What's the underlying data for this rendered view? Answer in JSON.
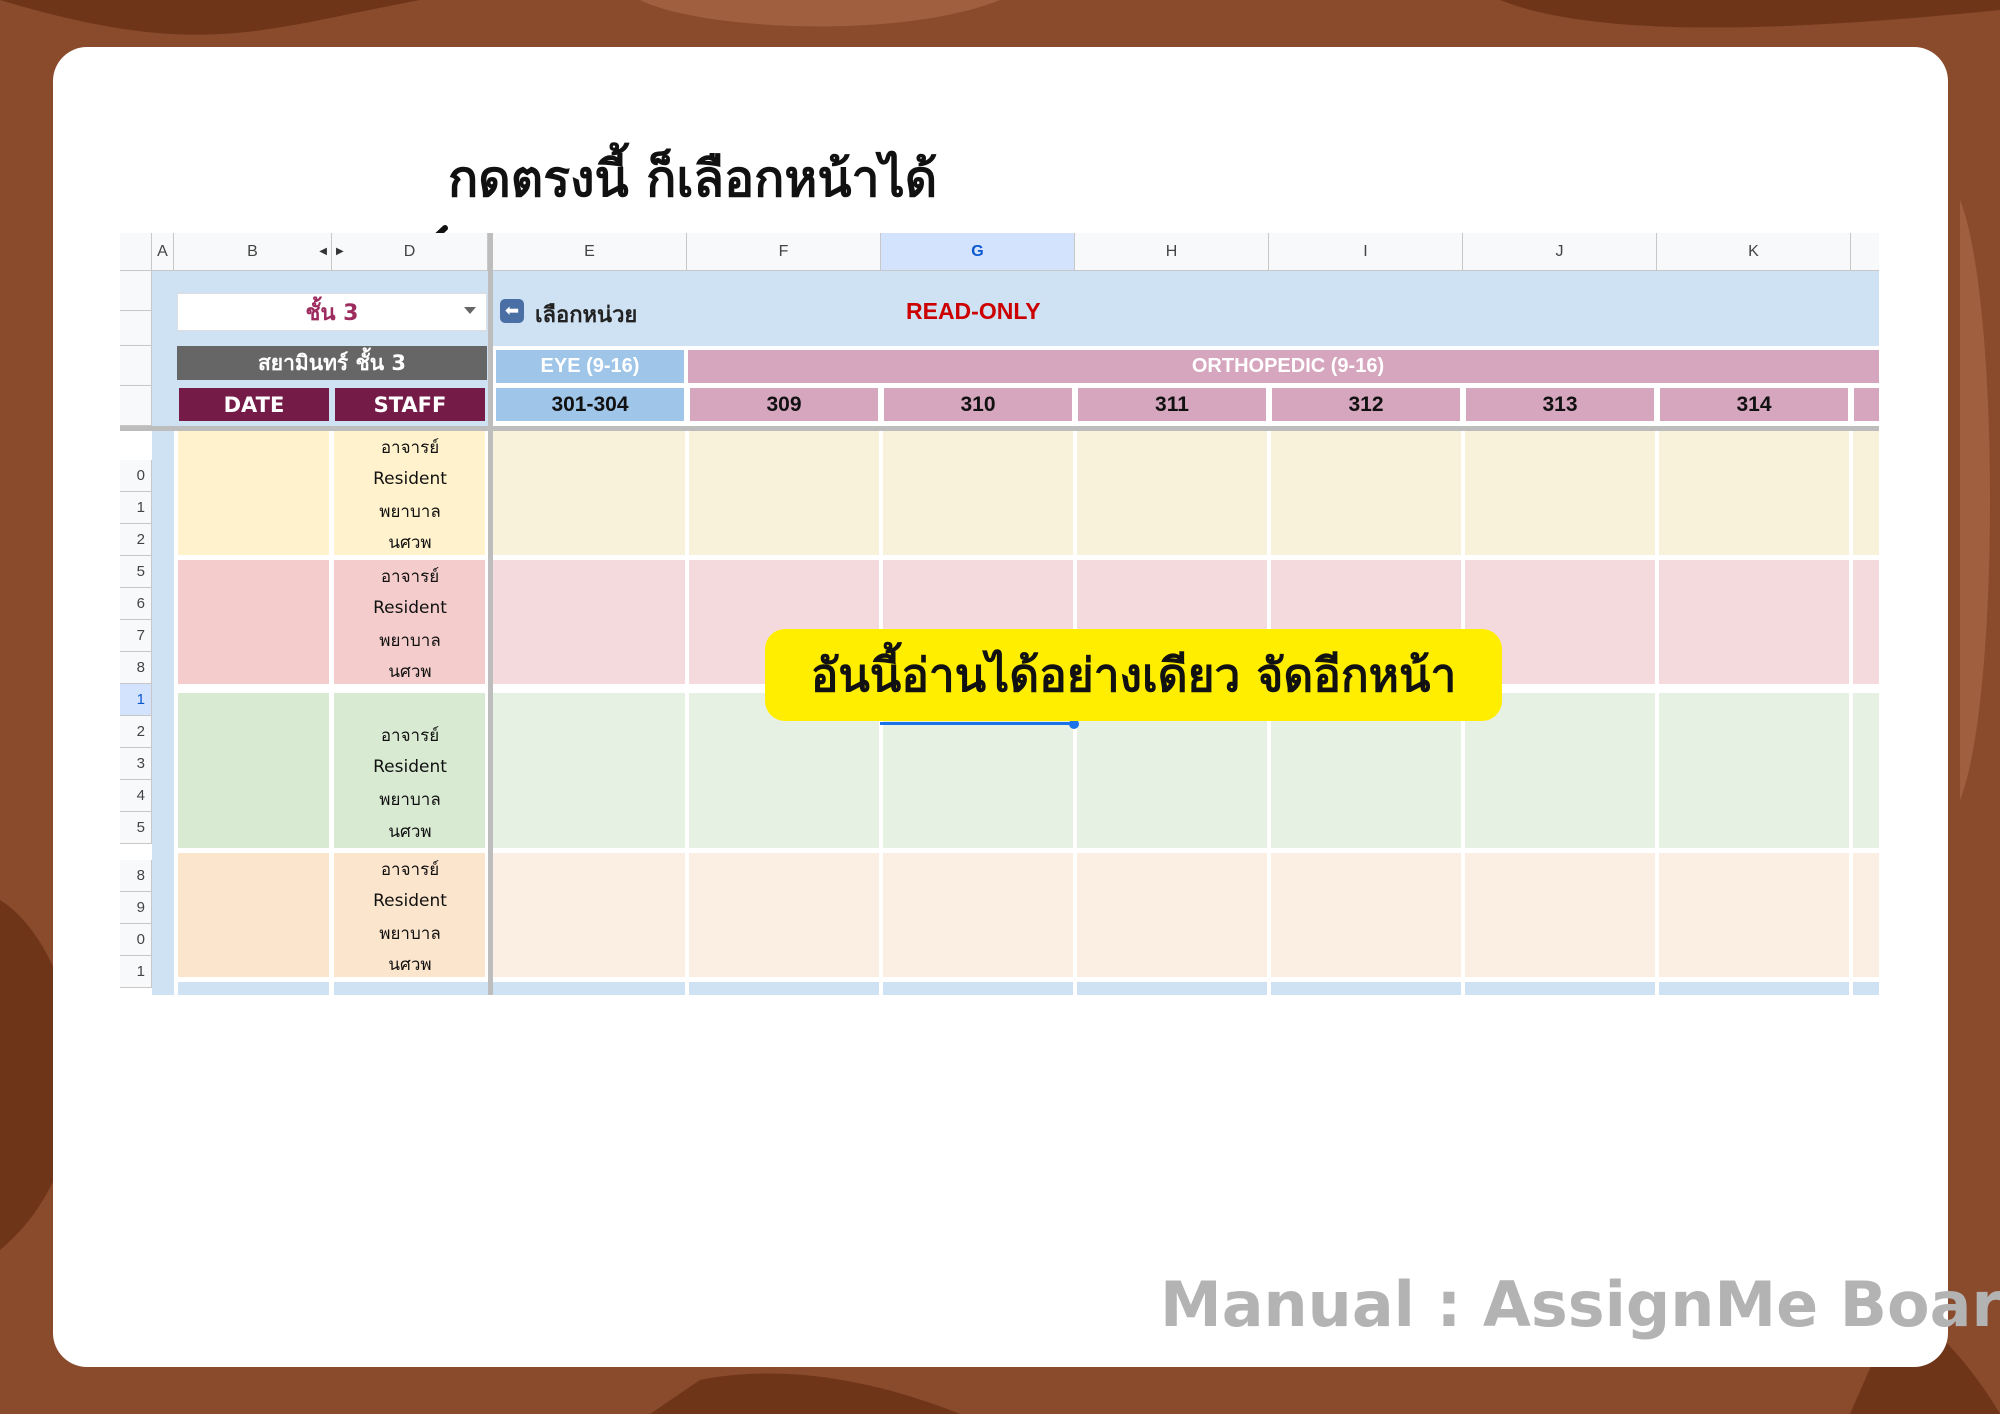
{
  "annotation_top": "กดตรงนี้ ก็เลือกหน้าได้",
  "annotation_banner": "อันนี้อ่านได้อย่างเดียว จัดอีกหน้า",
  "footer": "Manual : AssignMe Board",
  "colors": {
    "background": "#8a4a2c",
    "card": "#ffffff",
    "banner": "#ffee00",
    "readonly": "#cc0000",
    "maroon": "#741b47",
    "eye": "#9fc5e8",
    "ortho": "#d5a6bd"
  },
  "sheet": {
    "column_headers": [
      "A",
      "B",
      "D",
      "E",
      "F",
      "G",
      "H",
      "I",
      "J",
      "K"
    ],
    "selected_column": "G",
    "floor_selector": "ชั้น 3",
    "pick_unit_label": "เลือกหน่วย",
    "readonly_label": "READ-ONLY",
    "building_title": "สยามินทร์ ชั้น 3",
    "date_header": "DATE",
    "staff_header": "STAFF",
    "group_eye": "EYE (9-16)",
    "group_ortho": "ORTHOPEDIC (9-16)",
    "units": [
      "301-304",
      "309",
      "310",
      "311",
      "312",
      "313",
      "314"
    ],
    "row_numbers": [
      "0",
      "1",
      "2",
      "5",
      "6",
      "7",
      "8",
      "1",
      "2",
      "3",
      "4",
      "5",
      "8",
      "9",
      "0",
      "1"
    ],
    "staff_roles": [
      "อาจารย์",
      "Resident",
      "พยาบาล",
      "นศวพ"
    ],
    "shift_colors": [
      "#fff2cc",
      "#f4cccc",
      "#d9ead3",
      "#fce5cd"
    ],
    "shift_light_colors": [
      "#f9f2da",
      "#f5dadd",
      "#e7f1e3",
      "#faefe2"
    ]
  }
}
